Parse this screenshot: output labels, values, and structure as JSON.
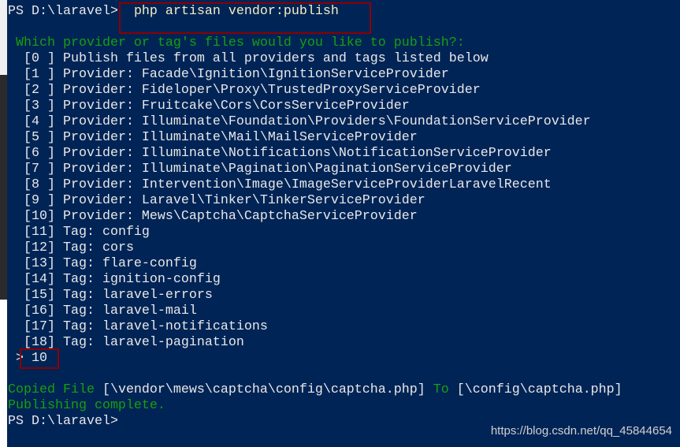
{
  "prompt": "PS D:\\laravel>",
  "command": "php artisan vendor:publish",
  "question": "Which provider or tag's files would you like to publish?:",
  "options": [
    "[0 ] Publish files from all providers and tags listed below",
    "[1 ] Provider: Facade\\Ignition\\IgnitionServiceProvider",
    "[2 ] Provider: Fideloper\\Proxy\\TrustedProxyServiceProvider",
    "[3 ] Provider: Fruitcake\\Cors\\CorsServiceProvider",
    "[4 ] Provider: Illuminate\\Foundation\\Providers\\FoundationServiceProvider",
    "[5 ] Provider: Illuminate\\Mail\\MailServiceProvider",
    "[6 ] Provider: Illuminate\\Notifications\\NotificationServiceProvider",
    "[7 ] Provider: Illuminate\\Pagination\\PaginationServiceProvider",
    "[8 ] Provider: Intervention\\Image\\ImageServiceProviderLaravelRecent",
    "[9 ] Provider: Laravel\\Tinker\\TinkerServiceProvider",
    "[10] Provider: Mews\\Captcha\\CaptchaServiceProvider",
    "[11] Tag: config",
    "[12] Tag: cors",
    "[13] Tag: flare-config",
    "[14] Tag: ignition-config",
    "[15] Tag: laravel-errors",
    "[16] Tag: laravel-mail",
    "[17] Tag: laravel-notifications",
    "[18] Tag: laravel-pagination"
  ],
  "input_prompt": ">",
  "input_value": "10",
  "copied": {
    "label": "Copied File",
    "from": "[\\vendor\\mews\\captcha\\config\\captcha.php]",
    "to_label": "To",
    "to": "[\\config\\captcha.php]"
  },
  "complete": "Publishing complete.",
  "final_prompt": "PS D:\\laravel>",
  "watermark": "https://blog.csdn.net/qq_45844654",
  "colors": {
    "background": "#012456",
    "green": "#16a00e",
    "highlight_box": "#8b0000"
  }
}
